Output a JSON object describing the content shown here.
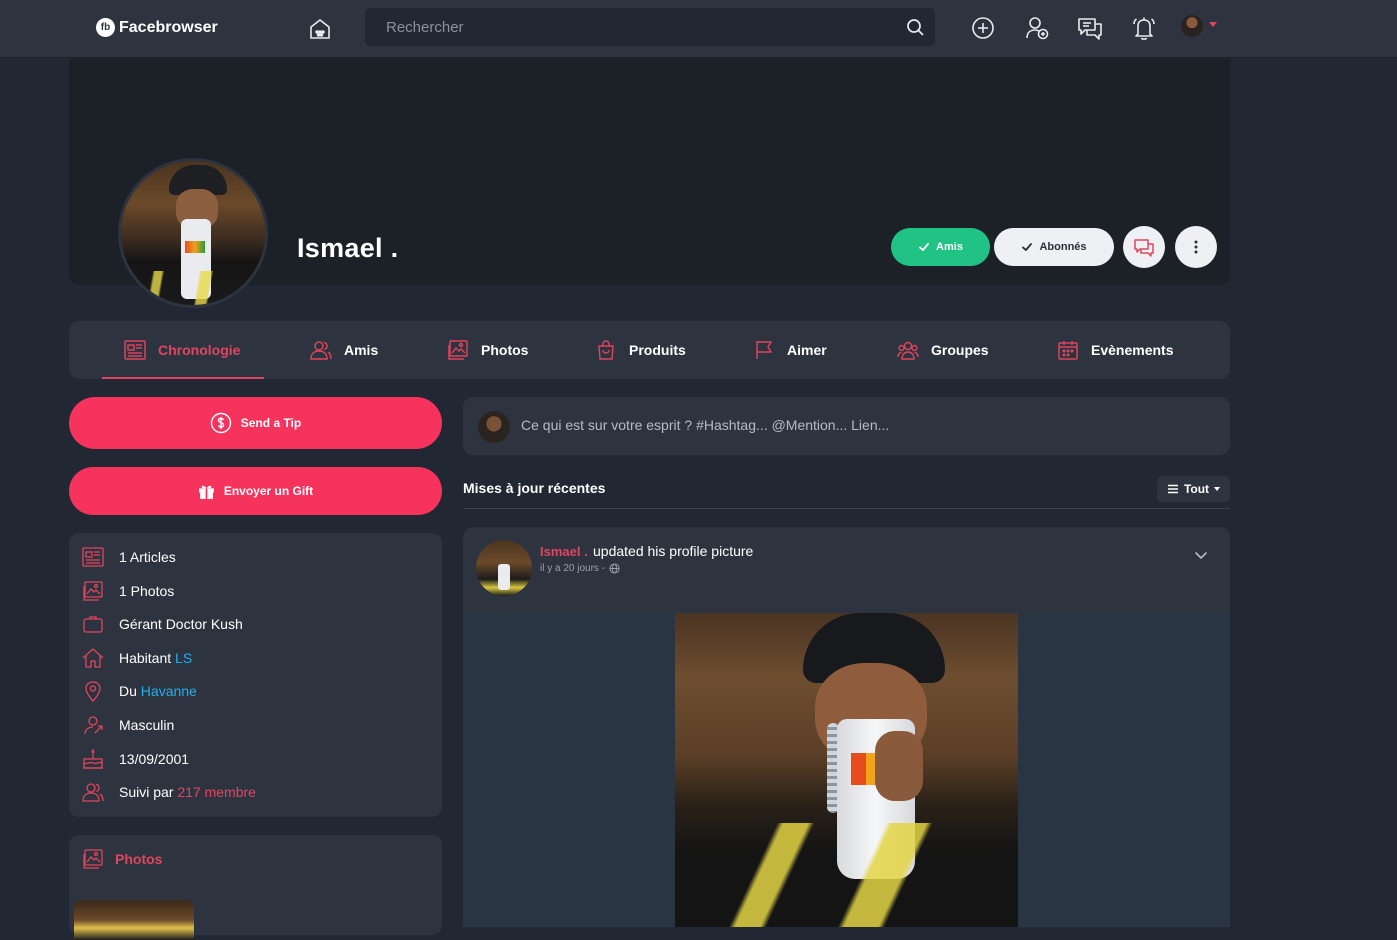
{
  "app": {
    "name": "Facebrowser",
    "logo_mark": "fb"
  },
  "search": {
    "placeholder": "Rechercher"
  },
  "topbar": {
    "icons": [
      "home-icon",
      "add-circle-icon",
      "add-user-icon",
      "messages-icon",
      "bell-icon"
    ],
    "avatar": "user-avatar"
  },
  "profile": {
    "name": "Ismael .",
    "buttons": {
      "friends": "Amis",
      "followers": "Abonnés"
    }
  },
  "tabs": [
    {
      "label": "Chronologie",
      "icon": "newspaper-icon",
      "active": true
    },
    {
      "label": "Amis",
      "icon": "users-icon"
    },
    {
      "label": "Photos",
      "icon": "image-icon"
    },
    {
      "label": "Produits",
      "icon": "shopping-bag-icon"
    },
    {
      "label": "Aimer",
      "icon": "flag-icon"
    },
    {
      "label": "Groupes",
      "icon": "groups-icon"
    },
    {
      "label": "Evènements",
      "icon": "calendar-icon"
    }
  ],
  "actions": {
    "tip": "Send a Tip",
    "gift": "Envoyer un Gift"
  },
  "info": {
    "articles": "1 Articles",
    "photos": "1 Photos",
    "job": "Gérant Doctor Kush",
    "lives_prefix": "Habitant",
    "lives_value": "LS",
    "from_prefix": "Du",
    "from_value": "Havanne",
    "gender": "Masculin",
    "birthday": "13/09/2001",
    "followed_prefix": "Suivi par",
    "followed_value": "217 membre"
  },
  "photos_card": {
    "title": "Photos"
  },
  "composer": {
    "placeholder": "Ce qui est sur votre esprit ? #Hashtag... @Mention... Lien..."
  },
  "feed": {
    "title": "Mises à jour récentes",
    "filter": "Tout",
    "post": {
      "author": "Ismael .",
      "action": "updated his profile picture",
      "time": "il y a 20 jours -"
    }
  },
  "colors": {
    "accent": "#e0455f",
    "tip_button": "#f5335d",
    "friends_green": "#21c384",
    "link_blue": "#22b0ef",
    "panel": "#2e343f",
    "background": "#222833"
  }
}
